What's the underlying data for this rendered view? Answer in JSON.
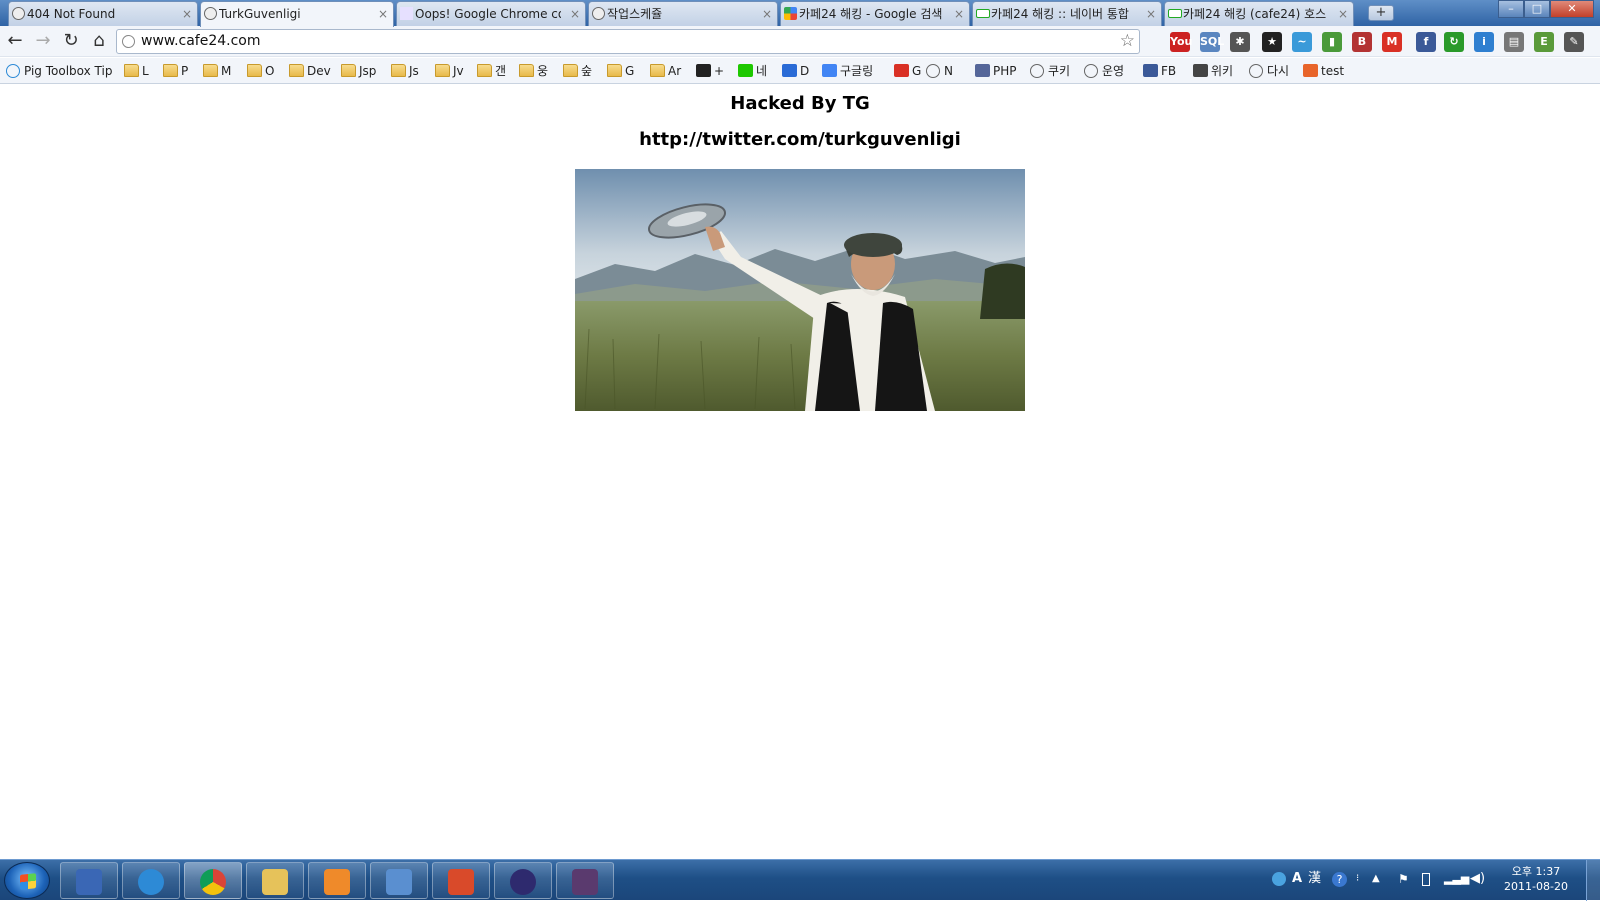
{
  "browser": {
    "tabs": [
      {
        "title": "404 Not Found",
        "icon": "globe-icon",
        "active": false
      },
      {
        "title": "TurkGuvenligi",
        "icon": "globe-icon",
        "active": true
      },
      {
        "title": "Oops! Google Chrome cou",
        "icon": "phpmyadmin-icon",
        "active": false
      },
      {
        "title": "작업스케쥴",
        "icon": "globe-icon",
        "active": false
      },
      {
        "title": "카페24 해킹 - Google 검색",
        "icon": "google-icon",
        "active": false
      },
      {
        "title": "카페24 해킹 :: 네이버 통합",
        "icon": "naver-icon",
        "active": false
      },
      {
        "title": "카페24 해킹 (cafe24) 호스",
        "icon": "naver-icon",
        "active": false
      }
    ],
    "new_tab_label": "+",
    "window_controls": {
      "minimize": "–",
      "maximize": "□",
      "close": "✕"
    },
    "toolbar": {
      "back_icon": "←",
      "forward_icon": "→",
      "reload_icon": "↻",
      "home_icon": "⌂",
      "url": "www.cafe24.com",
      "bookmark_star": "☆",
      "extensions": [
        {
          "name": "youtube-icon",
          "label": "You",
          "color": "#cc2222"
        },
        {
          "name": "sql-icon",
          "label": "SQL",
          "color": "#5a86c0"
        },
        {
          "name": "bug-icon",
          "label": "✱",
          "color": "#555555"
        },
        {
          "name": "star-ext-icon",
          "label": "★",
          "color": "#222222"
        },
        {
          "name": "bird-icon",
          "label": "~",
          "color": "#3a9ad9"
        },
        {
          "name": "evernote-icon",
          "label": "▮",
          "color": "#4a9a3a"
        },
        {
          "name": "bbc-icon",
          "label": "B",
          "color": "#b33333"
        },
        {
          "name": "gmail-icon",
          "label": "M",
          "color": "#d93025"
        },
        {
          "name": "facebook-icon",
          "label": "f",
          "color": "#3b5998"
        },
        {
          "name": "refresh-ext-icon",
          "label": "↻",
          "color": "#2a9a2a"
        },
        {
          "name": "info-ext-icon",
          "label": "i",
          "color": "#2f7fd0"
        },
        {
          "name": "printer-icon",
          "label": "▤",
          "color": "#777777"
        },
        {
          "name": "evernote-green-icon",
          "label": "E",
          "color": "#5a9a3a"
        },
        {
          "name": "wrench-icon",
          "label": "✎",
          "color": "#555555"
        }
      ]
    },
    "bookmarks": [
      {
        "label": "Pig Toolbox Tip",
        "icon": "ie-icon"
      },
      {
        "label": "L",
        "icon": "folder-icon"
      },
      {
        "label": "P",
        "icon": "folder-icon"
      },
      {
        "label": "M",
        "icon": "folder-icon"
      },
      {
        "label": "O",
        "icon": "folder-icon"
      },
      {
        "label": "Dev",
        "icon": "folder-icon"
      },
      {
        "label": "Jsp",
        "icon": "folder-icon"
      },
      {
        "label": "Js",
        "icon": "folder-icon"
      },
      {
        "label": "Jv",
        "icon": "folder-icon"
      },
      {
        "label": "갠",
        "icon": "folder-icon"
      },
      {
        "label": "웅",
        "icon": "folder-icon"
      },
      {
        "label": "숲",
        "icon": "folder-icon"
      },
      {
        "label": "G",
        "icon": "folder-icon"
      },
      {
        "label": "Ar",
        "icon": "folder-icon"
      },
      {
        "label": "+",
        "icon": "plus-icon"
      },
      {
        "label": "네",
        "icon": "naver-icon"
      },
      {
        "label": "D",
        "icon": "daum-icon"
      },
      {
        "label": "구글링",
        "icon": "google-icon"
      },
      {
        "label": "G",
        "icon": "gmail-icon"
      },
      {
        "label": "N",
        "icon": "globe-icon"
      },
      {
        "label": "PHP",
        "icon": "php-icon"
      },
      {
        "label": "쿠키",
        "icon": "globe-icon"
      },
      {
        "label": "운영",
        "icon": "globe-icon"
      },
      {
        "label": "FB",
        "icon": "facebook-icon"
      },
      {
        "label": "위키",
        "icon": "wikipedia-icon"
      },
      {
        "label": "다시",
        "icon": "globe-icon"
      },
      {
        "label": "test",
        "icon": "test-icon"
      }
    ]
  },
  "page": {
    "heading": "Hacked By TG",
    "link_text": "http://twitter.com/turkguvenligi",
    "image": {
      "subject": "old man with flying disc"
    }
  },
  "taskbar": {
    "apps": [
      {
        "name": "floppy-app-icon",
        "color": "#3a67b5",
        "active": false
      },
      {
        "name": "internet-explorer-icon",
        "color": "#2d8ad6",
        "active": false
      },
      {
        "name": "chrome-icon",
        "color": "#e0b020",
        "active": true
      },
      {
        "name": "file-explorer-icon",
        "color": "#e6c25a",
        "active": false
      },
      {
        "name": "media-player-icon",
        "color": "#ef8a2a",
        "active": false
      },
      {
        "name": "dolphin-app-icon",
        "color": "#5a8fd0",
        "active": false
      },
      {
        "name": "swirl-app-icon",
        "color": "#d94a2a",
        "active": false
      },
      {
        "name": "eclipse-icon",
        "color": "#2e2a6e",
        "active": false
      },
      {
        "name": "java-ee-ide-icon",
        "color": "#5a3a6e",
        "active": false
      }
    ],
    "tray": {
      "lang_icon": "A",
      "ime_icon": "漢",
      "help_icon": "?",
      "clock_time": "오후 1:37",
      "clock_date": "2011-08-20"
    }
  }
}
